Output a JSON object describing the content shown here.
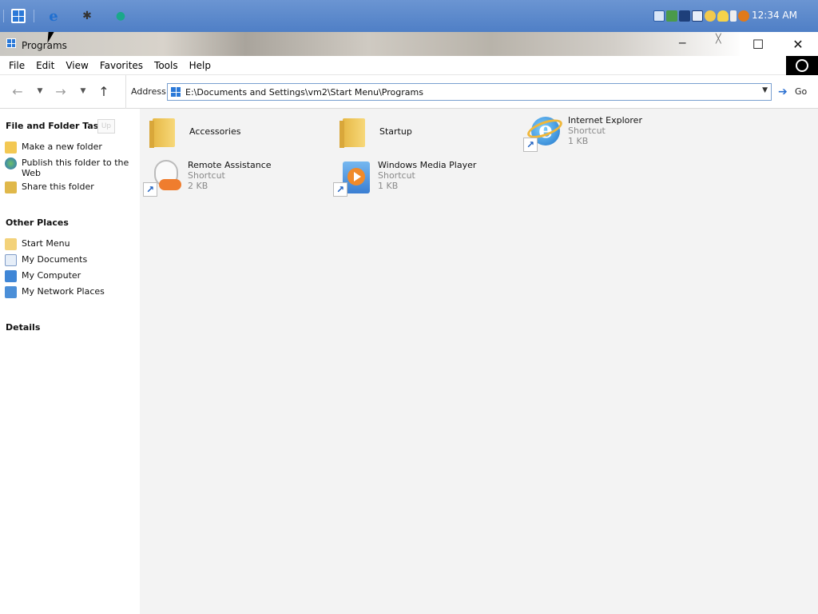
{
  "taskbar": {
    "clock": "12:34 AM",
    "quick_launch": [
      "windows-start-icon",
      "internet-explorer-icon",
      "bug-icon",
      "media-icon"
    ],
    "tray_icons": [
      "display-icon",
      "pen-icon",
      "monitor-icon",
      "grid-icon",
      "chat-icon",
      "shield-icon",
      "usb-icon",
      "search-icon"
    ]
  },
  "window": {
    "title": "Programs"
  },
  "menu": {
    "items": [
      "File",
      "Edit",
      "View",
      "Favorites",
      "Tools",
      "Help"
    ]
  },
  "toolbar": {
    "address_label": "Address",
    "address_value": "E:\\Documents and Settings\\vm2\\Start Menu\\Programs",
    "go_label": "Go"
  },
  "left_pane": {
    "file_tasks_title": "File and Folder Tasks",
    "collapse_label": "Up",
    "file_tasks": [
      {
        "label": "Make a new folder",
        "icon": "new-folder-icon"
      },
      {
        "label": "Publish this folder to the Web",
        "icon": "globe-icon"
      },
      {
        "label": "Share this folder",
        "icon": "share-icon"
      }
    ],
    "other_places_title": "Other Places",
    "other_places": [
      {
        "label": "Start Menu",
        "icon": "folder-icon"
      },
      {
        "label": "My Documents",
        "icon": "documents-icon"
      },
      {
        "label": "My Computer",
        "icon": "computer-icon"
      },
      {
        "label": "My Network Places",
        "icon": "network-icon"
      }
    ],
    "details_title": "Details"
  },
  "files": [
    {
      "name": "Accessories",
      "type": "",
      "size": "",
      "icon": "folder-icon"
    },
    {
      "name": "Startup",
      "type": "",
      "size": "",
      "icon": "folder-icon"
    },
    {
      "name": "Internet Explorer",
      "type": "Shortcut",
      "size": "1 KB",
      "icon": "internet-explorer-icon"
    },
    {
      "name": "Remote Assistance",
      "type": "Shortcut",
      "size": "2 KB",
      "icon": "remote-assistance-icon"
    },
    {
      "name": "Windows Media Player",
      "type": "Shortcut",
      "size": "1 KB",
      "icon": "media-player-icon"
    }
  ]
}
